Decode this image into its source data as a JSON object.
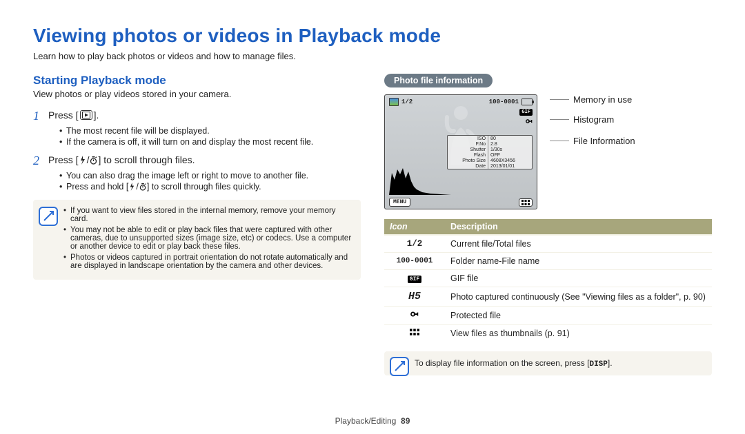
{
  "title": "Viewing photos or videos in Playback mode",
  "lead": "Learn how to play back photos or videos and how to manage files.",
  "section_heading": "Starting Playback mode",
  "section_desc": "View photos or play videos stored in your camera.",
  "step1_prefix": "Press [",
  "step1_suffix": "].",
  "step1_num": "1",
  "step1_bullets": [
    "The most recent file will be displayed.",
    "If the camera is off, it will turn on and display the most recent file."
  ],
  "step2_num": "2",
  "step2_prefix": "Press [",
  "step2_mid": "/",
  "step2_suffix": "] to scroll through files.",
  "step2_bullets": [
    "You can also drag the image left or right to move to another file.",
    "Press and hold [",
    "] to scroll through files quickly."
  ],
  "note_bullets": [
    "If you want to view files stored in the internal memory, remove your memory card.",
    "You may not be able to edit or play back files that were captured with other cameras, due to unsupported sizes (image size, etc) or codecs. Use a computer or another device to edit or play back these files.",
    "Photos or videos captured in portrait orientation do not rotate automatically and are displayed in landscape orientation by the camera and other devices."
  ],
  "pill": "Photo file information",
  "screen": {
    "counter": "1/2",
    "folder_file": "100-0001",
    "info": [
      [
        "ISO",
        "80"
      ],
      [
        "F.No",
        "2.8"
      ],
      [
        "Shutter",
        "1/30s"
      ],
      [
        "Flash",
        "OFF"
      ],
      [
        "Photo Size",
        "4608X3456"
      ],
      [
        "Date",
        "2013/01/01"
      ]
    ],
    "menu": "MENU",
    "gif": "GIF"
  },
  "callouts": {
    "memory": "Memory in use",
    "histogram": "Histogram",
    "fileinfo": "File Information"
  },
  "table": {
    "head_icon": "Icon",
    "head_desc": "Description",
    "rows": [
      {
        "icon_text": "1/2",
        "desc": "Current file/Total files"
      },
      {
        "icon_text": "100-0001",
        "desc": "Folder name-File name"
      },
      {
        "icon_text": "GIF",
        "icon_style": "gif",
        "desc": "GIF file"
      },
      {
        "icon_text": "H5",
        "icon_style": "bolditalic",
        "desc": "Photo captured continuously (See \"Viewing files as a folder\", p. 90)"
      },
      {
        "icon_kind": "lock",
        "desc": "Protected file"
      },
      {
        "icon_kind": "grid",
        "desc": "View files as thumbnails (p. 91)"
      }
    ]
  },
  "note_single_pre": "To display file information on the screen, press [",
  "note_single_btn": "DISP",
  "note_single_post": "].",
  "footer_section": "Playback/Editing",
  "footer_page": "89"
}
